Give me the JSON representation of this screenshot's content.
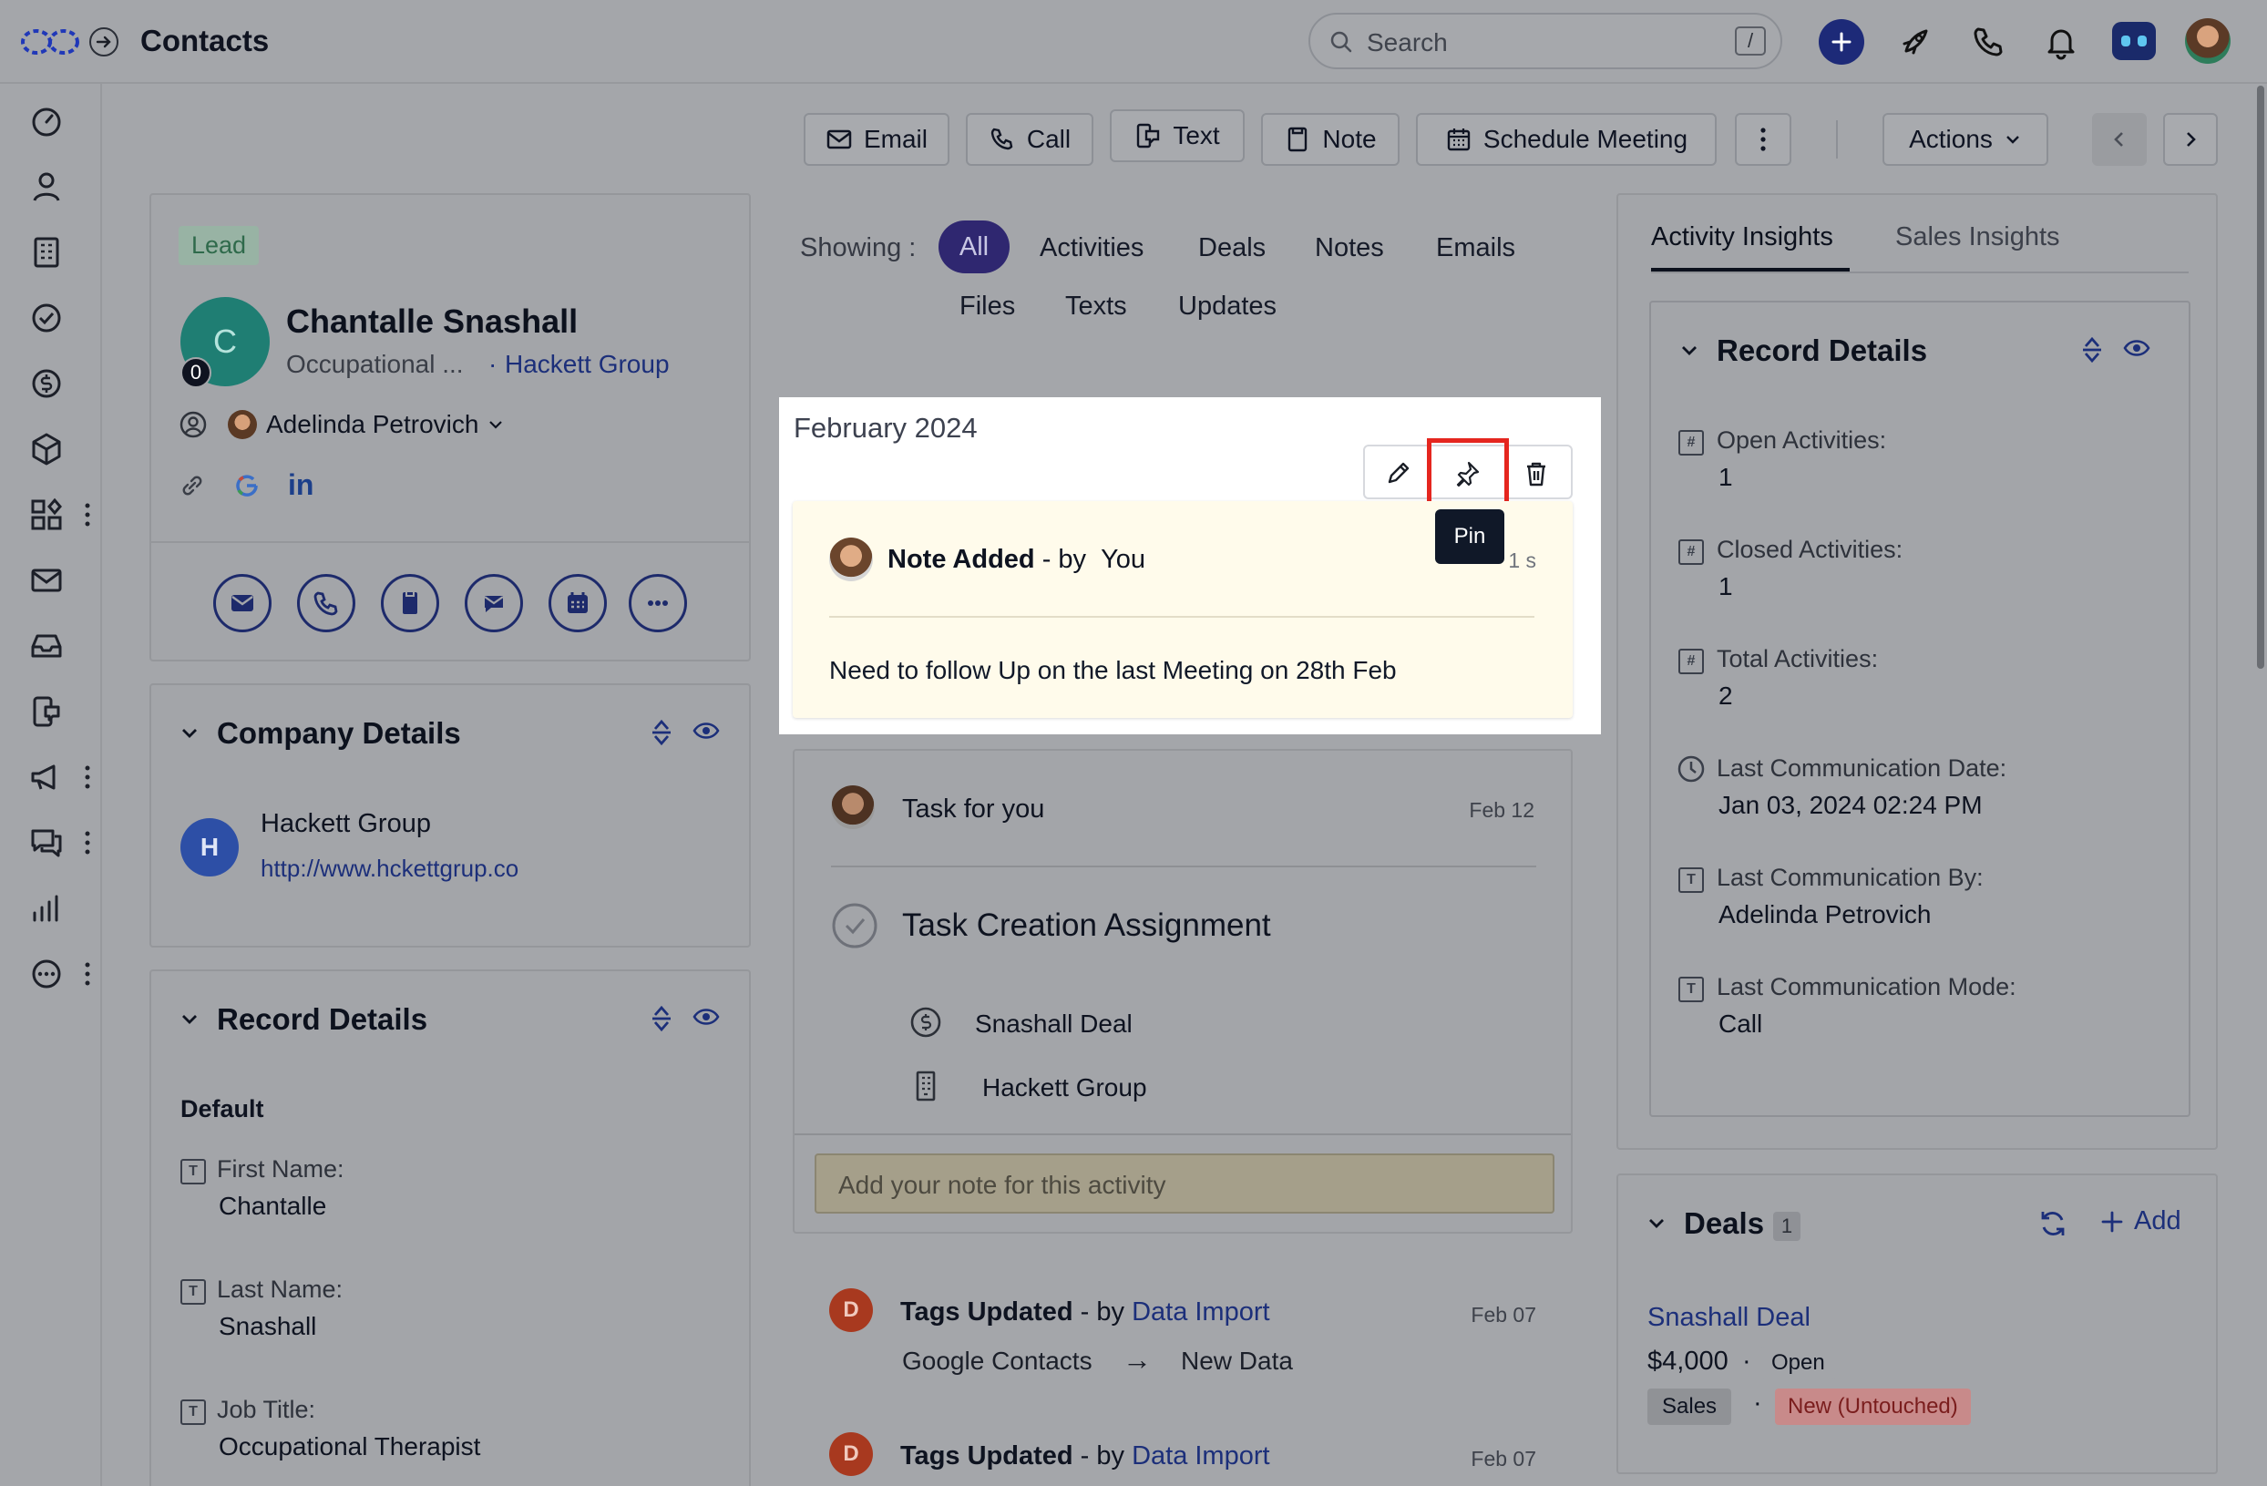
{
  "header": {
    "title": "Contacts",
    "search_placeholder": "Search",
    "search_shortcut": "/"
  },
  "toolbar": {
    "email": "Email",
    "call": "Call",
    "text": "Text",
    "note": "Note",
    "schedule": "Schedule Meeting",
    "actions": "Actions"
  },
  "contact": {
    "badge": "Lead",
    "avatar_letter": "C",
    "avatar_count": "0",
    "name": "Chantalle Snashall",
    "title": "Occupational ...",
    "separator": "·",
    "company": "Hackett Group",
    "owner": "Adelinda Petrovich"
  },
  "company_details": {
    "heading": "Company Details",
    "avatar_letter": "H",
    "name": "Hackett Group",
    "url": "http://www.hckettgrup.co"
  },
  "record_details_left": {
    "heading": "Record Details",
    "group": "Default",
    "fields": [
      {
        "label": "First Name:",
        "value": "Chantalle"
      },
      {
        "label": "Last Name:",
        "value": "Snashall"
      },
      {
        "label": "Job Title:",
        "value": "Occupational Therapist"
      }
    ]
  },
  "filters": {
    "showing": "Showing :",
    "items": [
      "All",
      "Activities",
      "Deals",
      "Notes",
      "Emails",
      "Files",
      "Texts",
      "Updates"
    ]
  },
  "timeline": {
    "month": "February 2024",
    "tooltip": "Pin",
    "note": {
      "title": "Note Added",
      "by": "- by",
      "author": "You",
      "time": "1 s",
      "body": "Need to follow Up on the last Meeting on 28th Feb"
    },
    "task": {
      "header": "Task",
      "for": "for you",
      "date": "Feb 12",
      "title": "Task Creation Assignment",
      "deal": "Snashall Deal",
      "company": "Hackett Group",
      "note_placeholder": "Add your note for this activity"
    },
    "updates": [
      {
        "avatar": "D",
        "title": "Tags Updated",
        "by": "- by",
        "source": "Data Import",
        "date": "Feb 07",
        "from": "Google Contacts",
        "arrow": "→",
        "to": "New Data"
      },
      {
        "avatar": "D",
        "title": "Tags Updated",
        "by": "- by",
        "source": "Data Import",
        "date": "Feb 07"
      }
    ]
  },
  "insights": {
    "tabs": [
      "Activity Insights",
      "Sales Insights"
    ],
    "heading": "Record Details",
    "fields": [
      {
        "label": "Open Activities:",
        "value": "1"
      },
      {
        "label": "Closed Activities:",
        "value": "1"
      },
      {
        "label": "Total Activities:",
        "value": "2"
      },
      {
        "label": "Last Communication Date:",
        "value": "Jan 03, 2024 02:24 PM"
      },
      {
        "label": "Last Communication By:",
        "value": "Adelinda Petrovich"
      },
      {
        "label": "Last Communication Mode:",
        "value": "Call"
      }
    ]
  },
  "deals": {
    "heading": "Deals",
    "count": "1",
    "add": "Add",
    "deal_name": "Snashall Deal",
    "amount": "$4,000",
    "dot": "·",
    "status": "Open",
    "pipeline": "Sales",
    "stage": "New (Untouched)"
  },
  "colors": {
    "accent": "#2f3a8f",
    "highlight_box": "#e5261f",
    "note_bg": "#fffbeb",
    "tooltip_bg": "#101828",
    "stage_bg": "#c88a8a"
  }
}
